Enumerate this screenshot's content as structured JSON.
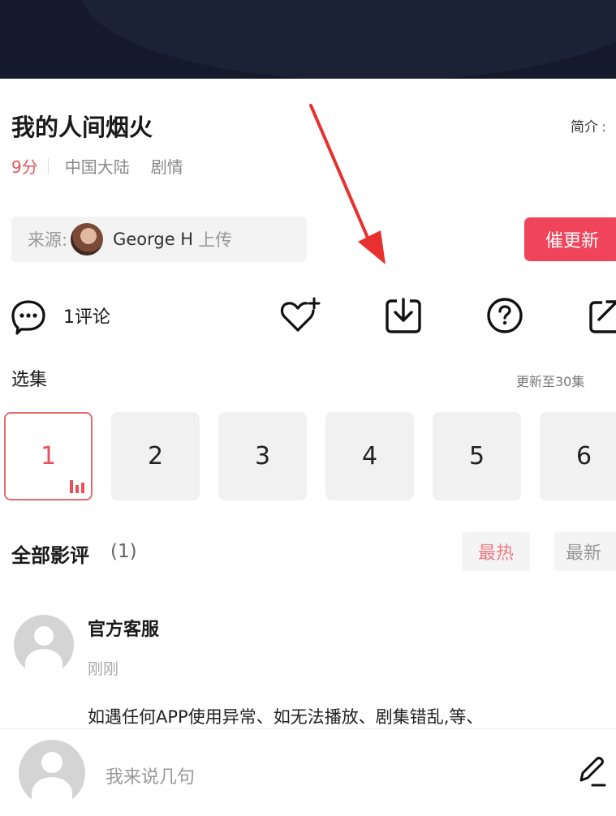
{
  "show": {
    "title": "我的人间烟火",
    "intro_link": "简介",
    "score": "9分",
    "region": "中国大陆",
    "genre": "剧情"
  },
  "source": {
    "label": "来源:",
    "uploader": "George H",
    "suffix": "上传"
  },
  "urge_update_label": "催更新",
  "actions": {
    "comment_label": "1评论",
    "icons": [
      "comment-icon",
      "favorite-add-icon",
      "download-icon",
      "help-icon",
      "share-icon"
    ]
  },
  "episodes": {
    "header": "选集",
    "update_status": "更新至30集",
    "items": [
      "1",
      "2",
      "3",
      "4",
      "5",
      "6"
    ],
    "active_index": 0
  },
  "reviews": {
    "header": "全部影评",
    "count": "(1)",
    "sort_hot": "最热",
    "sort_new": "最新",
    "items": [
      {
        "author": "官方客服",
        "time": "刚刚",
        "text": "如遇任何APP使用异常、如无法播放、剧集错乱,等、"
      }
    ]
  },
  "composer": {
    "placeholder": "我来说几句"
  },
  "colors": {
    "accent": "#f0445a",
    "score": "#e8505b",
    "banner": "#141a2b",
    "annotation_arrow": "#e8302e"
  }
}
